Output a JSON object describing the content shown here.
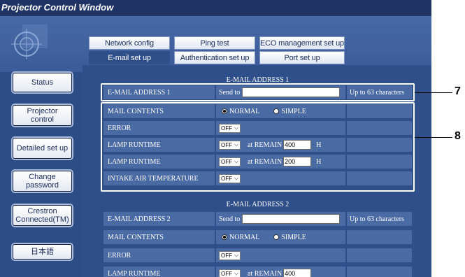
{
  "window": {
    "title": "Projector Control Window"
  },
  "sidebar": {
    "items": [
      {
        "label": "Status"
      },
      {
        "label": "Projector control"
      },
      {
        "label": "Detailed set up"
      },
      {
        "label": "Change password"
      },
      {
        "label": "Crestron Connected(TM)"
      },
      {
        "label": "日本語"
      }
    ]
  },
  "tabs": {
    "row1": [
      {
        "label": "Network config"
      },
      {
        "label": "Ping test"
      },
      {
        "label": "ECO management set up"
      }
    ],
    "row2": [
      {
        "label": "E-mail set up",
        "active": true
      },
      {
        "label": "Authentication set up"
      },
      {
        "label": "Port set up"
      }
    ]
  },
  "email1": {
    "header": "E-MAIL ADDRESS 1",
    "address_label": "E-MAIL ADDRESS 1",
    "send_to": "Send to",
    "address_value": "",
    "char_limit": "Up to 63 characters",
    "mail_contents_label": "MAIL CONTENTS",
    "normal_label": "NORMAL",
    "simple_label": "SIMPLE",
    "selected_contents": "NORMAL",
    "error_label": "ERROR",
    "error_value": "OFF",
    "lamp1_label": "LAMP RUNTIME",
    "lamp1_value": "OFF",
    "lamp1_remain_label": "at REMAIN",
    "lamp1_remain_value": "400",
    "lamp1_unit": "H",
    "lamp2_label": "LAMP RUNTIME",
    "lamp2_value": "OFF",
    "lamp2_remain_label": "at REMAIN",
    "lamp2_remain_value": "200",
    "lamp2_unit": "H",
    "intake_label": "INTAKE AIR TEMPERATURE",
    "intake_value": "OFF"
  },
  "email2": {
    "header": "E-MAIL ADDRESS 2",
    "address_label": "E-MAIL ADDRESS 2",
    "send_to": "Send to",
    "address_value": "",
    "char_limit": "Up to 63 characters",
    "mail_contents_label": "MAIL CONTENTS",
    "normal_label": "NORMAL",
    "simple_label": "SIMPLE",
    "selected_contents": "NORMAL",
    "error_label": "ERROR",
    "error_value": "OFF",
    "lamp1_label": "LAMP RUNTIME",
    "lamp1_value": "OFF",
    "lamp1_remain_label": "at REMAIN",
    "lamp1_remain_value": "400"
  },
  "callouts": {
    "c7": "7",
    "c8": "8"
  },
  "colors": {
    "window_bg": "#2d4d86",
    "title_bar": "#1f3464",
    "cell_bg": "#4a6aa4",
    "active_tab": "#2f4f8a",
    "callout_frame": "#ffffff"
  }
}
